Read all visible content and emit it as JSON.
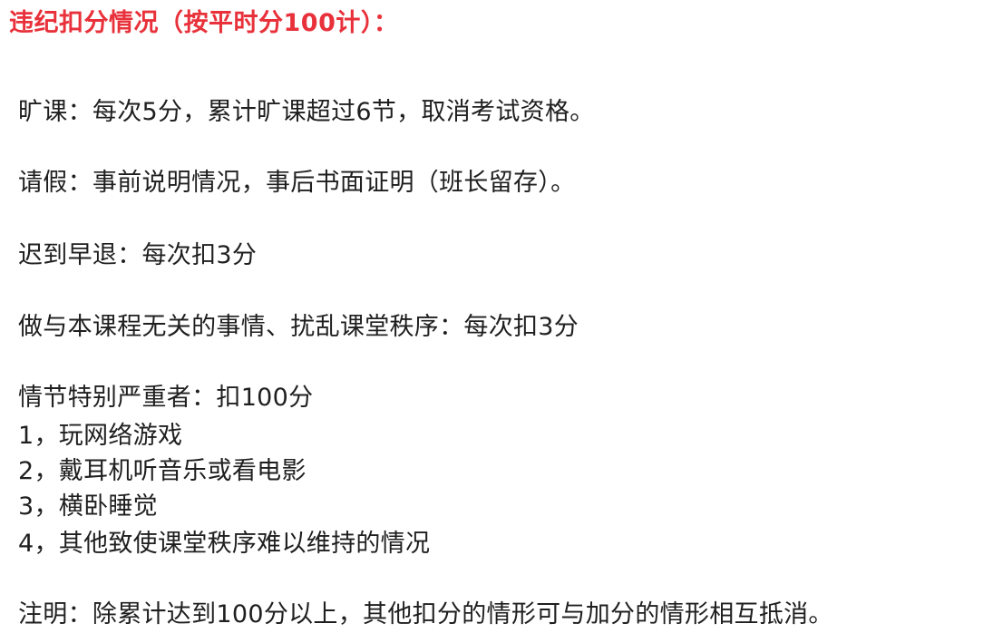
{
  "title": "违纪扣分情况（按平时分100计）：",
  "rules": {
    "absence": "旷课：每次5分，累计旷课超过6节，取消考试资格。",
    "leave": "请假：事前说明情况，事后书面证明（班长留存）。",
    "late": "迟到早退：每次扣3分",
    "disruption": "做与本课程无关的事情、扰乱课堂秩序：每次扣3分",
    "serious": "情节特别严重者：扣100分"
  },
  "serious_items": [
    "1，玩网络游戏",
    "2，戴耳机听音乐或看电影",
    "3，横卧睡觉",
    "4，其他致使课堂秩序难以维持的情况"
  ],
  "note": "注明：除累计达到100分以上，其他扣分的情形可与加分的情形相互抵消。",
  "colors": {
    "title": "#e8313a",
    "text": "#1f1f1f",
    "background": "#ffffff"
  }
}
